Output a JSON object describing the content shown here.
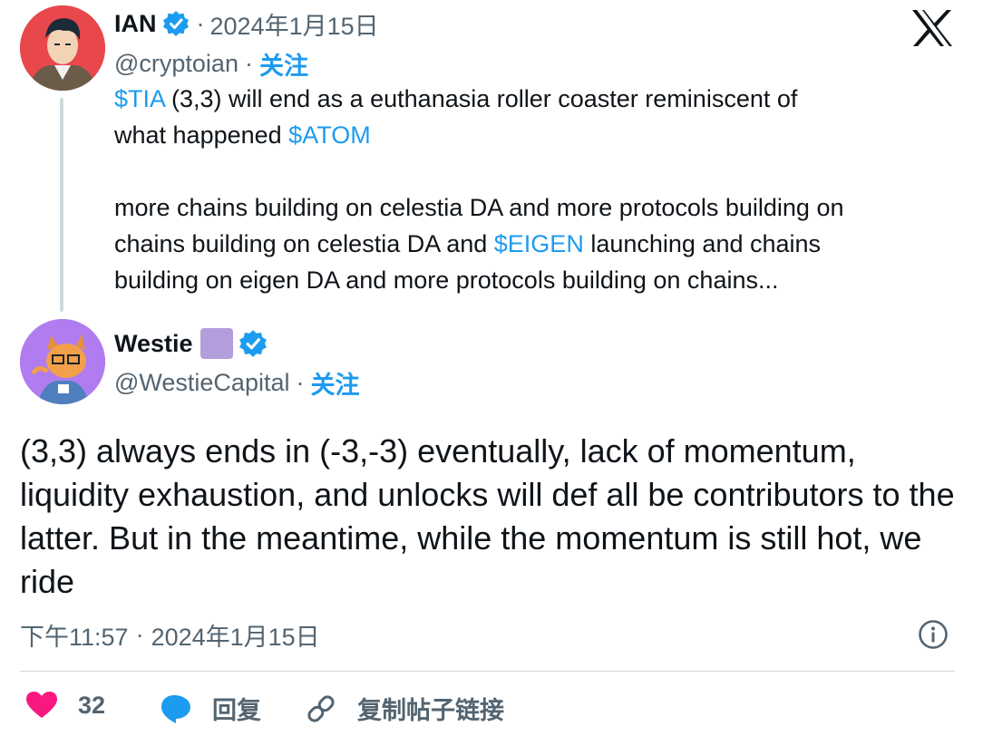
{
  "quoted": {
    "name": "IAN",
    "timestamp": "2024年1月15日",
    "handle": "@cryptoian",
    "follow_label": "关注",
    "text": {
      "l1_tag": "$TIA",
      "l1_rest": " (3,3) will end as a euthanasia roller coaster reminiscent of",
      "l2_pre": "what happened ",
      "l2_tag": "$ATOM",
      "p2_l1": "more chains building on celestia DA and more protocols building on",
      "p2_l2_pre": "chains building on celestia DA and ",
      "p2_l2_tag": "$EIGEN",
      "p2_l2_post": " launching and chains",
      "p2_l3": "building on eigen DA and more protocols building on chains..."
    }
  },
  "main": {
    "name": "Westie",
    "handle": "@WestieCapital",
    "follow_label": "关注",
    "text": "(3,3) always ends in (-3,-3) eventually, lack of momentum, liquidity exhaustion, and unlocks will def all be contributors to the latter. But in the meantime, while the momentum is still hot, we ride",
    "time": "下午11:57",
    "date": "2024年1月15日"
  },
  "actions": {
    "like_count": "32",
    "reply_label": "回复",
    "copy_link_label": "复制帖子链接"
  },
  "separator": "·",
  "colors": {
    "accent": "#1d9bf0",
    "like": "#f91880",
    "verified": "#1d9bf0",
    "emoji_square": "#b39ddb"
  },
  "icons": [
    "x-logo-icon",
    "verified-badge-icon",
    "purple-square-icon",
    "info-icon",
    "heart-icon",
    "reply-bubble-icon",
    "link-icon"
  ]
}
